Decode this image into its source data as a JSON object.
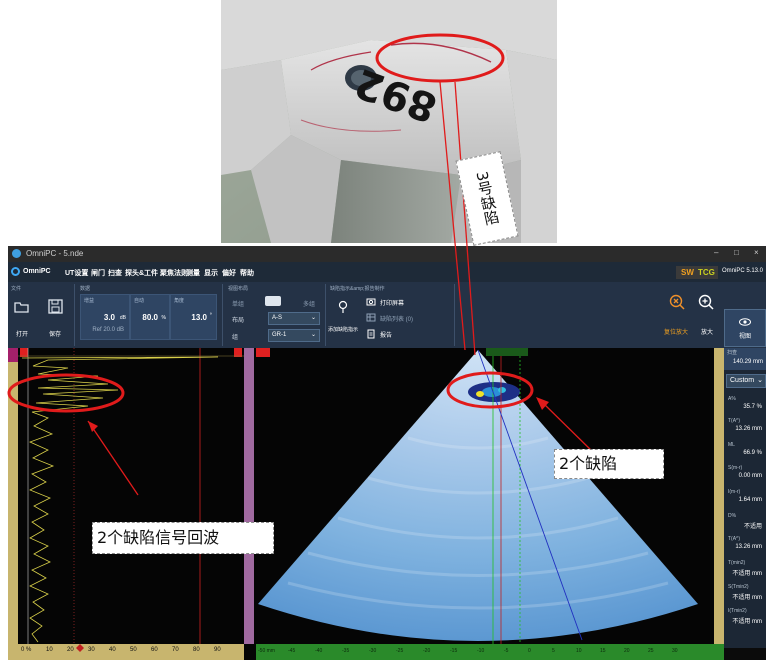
{
  "window": {
    "title": "OmniPC - 5.nde",
    "min": "–",
    "max": "□",
    "close": "×"
  },
  "menubar": {
    "brand": "OmniPC",
    "items": [
      "UT设置",
      "闸门",
      "扫查",
      "探头&工件",
      "聚焦法则",
      "测量",
      "显示",
      "偏好",
      "帮助"
    ],
    "sw_tcg": {
      "sw": "SW",
      "tcg": "TCG"
    },
    "version": "OmniPC 5.13.0"
  },
  "ribbon": {
    "file": {
      "title": "文件",
      "open": "打开",
      "save": "保存"
    },
    "data": {
      "title": "数据",
      "gain": {
        "label": "增益",
        "value": "3.0",
        "unit": "dB",
        "ref": "Ref 20.0 dB"
      },
      "auto": {
        "label": "自动",
        "value": "80.0",
        "unit": "%"
      },
      "angle": {
        "label": "角度",
        "value": "13.0",
        "unit": "°"
      }
    },
    "layout": {
      "title": "视图布局",
      "single": "单组",
      "multi": "多组",
      "view_label": "布局",
      "view_value": "A-S",
      "group_label": "组",
      "group_value": "GR-1"
    },
    "defects": {
      "title": "缺陷指示&amp;报告制作",
      "add": "添加缺陷指示",
      "print": "打印屏幕",
      "list": "缺陷列表 (0)",
      "report": "报告"
    },
    "zoom": {
      "reset": "复位放大",
      "zoom": "放大",
      "view": "视图"
    }
  },
  "right_panel": {
    "head_label": "扫查",
    "head_value": "140.29 mm",
    "preset": "Custom",
    "readings": [
      {
        "label": "A%",
        "value": "35.7 %"
      },
      {
        "label": "T(A^)",
        "value": "13.26 mm"
      },
      {
        "label": "ML",
        "value": "66.9 %"
      },
      {
        "label": "S(m-r)",
        "value": "0.00 mm"
      },
      {
        "label": "I(m-r)",
        "value": "1.64 mm"
      },
      {
        "label": "D%",
        "value": "不适用"
      },
      {
        "label": "T(A^)",
        "value": "13.26 mm"
      },
      {
        "label": "T(min2)",
        "value": "不适用 mm"
      },
      {
        "label": "S(Tmin2)",
        "value": "不适用 mm"
      },
      {
        "label": "I(Tmin2)",
        "value": "不适用 mm"
      }
    ]
  },
  "ascan_axis": [
    "0 %",
    "10",
    "20",
    "30",
    "40",
    "50",
    "60",
    "70",
    "80",
    "90"
  ],
  "sscan_axis": [
    "-50 mm",
    "-45",
    "-40",
    "-35",
    "-30",
    "-25",
    "-20",
    "-15",
    "-10",
    "-5",
    "0",
    "5",
    "10",
    "15",
    "20",
    "25",
    "30"
  ],
  "photo": {
    "marking": "892"
  },
  "annotations": {
    "defect3": "3号缺陷",
    "two_defects": "2个缺陷",
    "two_defects_echo": "2个缺陷信号回波"
  },
  "colors": {
    "accent_red": "#e01b1b",
    "menu_bg": "#1e2a38",
    "ribbon_bg": "#243246",
    "scan_blue": "#7fb2df"
  }
}
